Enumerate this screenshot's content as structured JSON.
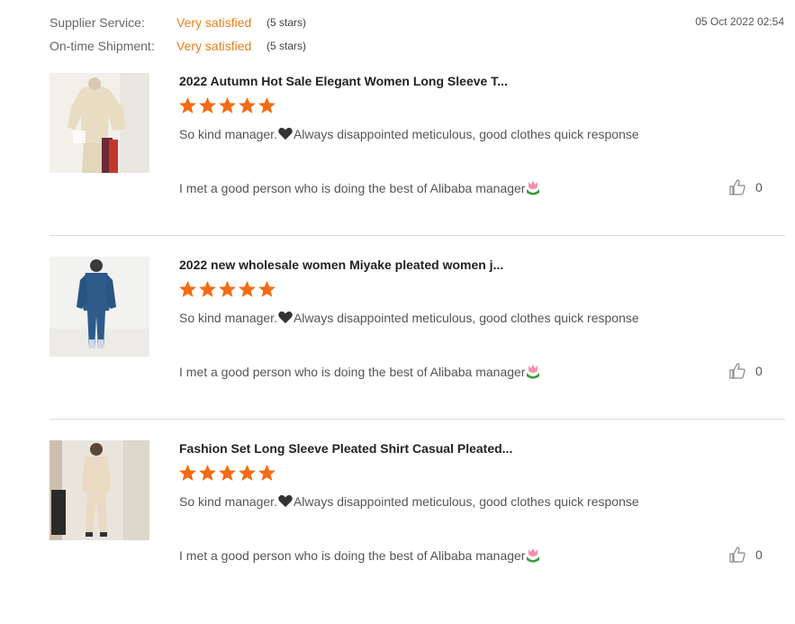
{
  "header": {
    "supplier_service_label": "Supplier Service:",
    "supplier_service_value": "Very satisfied",
    "supplier_service_stars": "(5 stars)",
    "ontime_label": "On-time Shipment:",
    "ontime_value": "Very satisfied",
    "ontime_stars": "(5 stars)",
    "date": "05 Oct 2022 02:54"
  },
  "colors": {
    "accent": "#e8801e",
    "star": "#f56b12",
    "divider": "#dedede"
  },
  "reviews": [
    {
      "title": "2022 Autumn Hot Sale Elegant Women Long Sleeve T...",
      "rating": 5,
      "body_a": "So kind manager.",
      "body_b": "Always disappointed meticulous, good clothes quick response",
      "reply": "I met a good person who is doing the best of Alibaba manager",
      "likes": "0",
      "thumb_icon": "product-photo-beige-pleated-top"
    },
    {
      "title": "2022 new wholesale women Miyake pleated women j...",
      "rating": 5,
      "body_a": "So kind manager.",
      "body_b": "Always disappointed meticulous, good clothes quick response",
      "reply": "I met a good person who is doing the best of Alibaba manager",
      "likes": "0",
      "thumb_icon": "product-photo-denim-jumpsuit"
    },
    {
      "title": "Fashion Set Long Sleeve Pleated Shirt Casual Pleated...",
      "rating": 5,
      "body_a": "So kind manager.",
      "body_b": "Always disappointed meticulous, good clothes quick response",
      "reply": "I met a good person who is doing the best of Alibaba manager",
      "likes": "0",
      "thumb_icon": "product-photo-pleated-set"
    }
  ]
}
